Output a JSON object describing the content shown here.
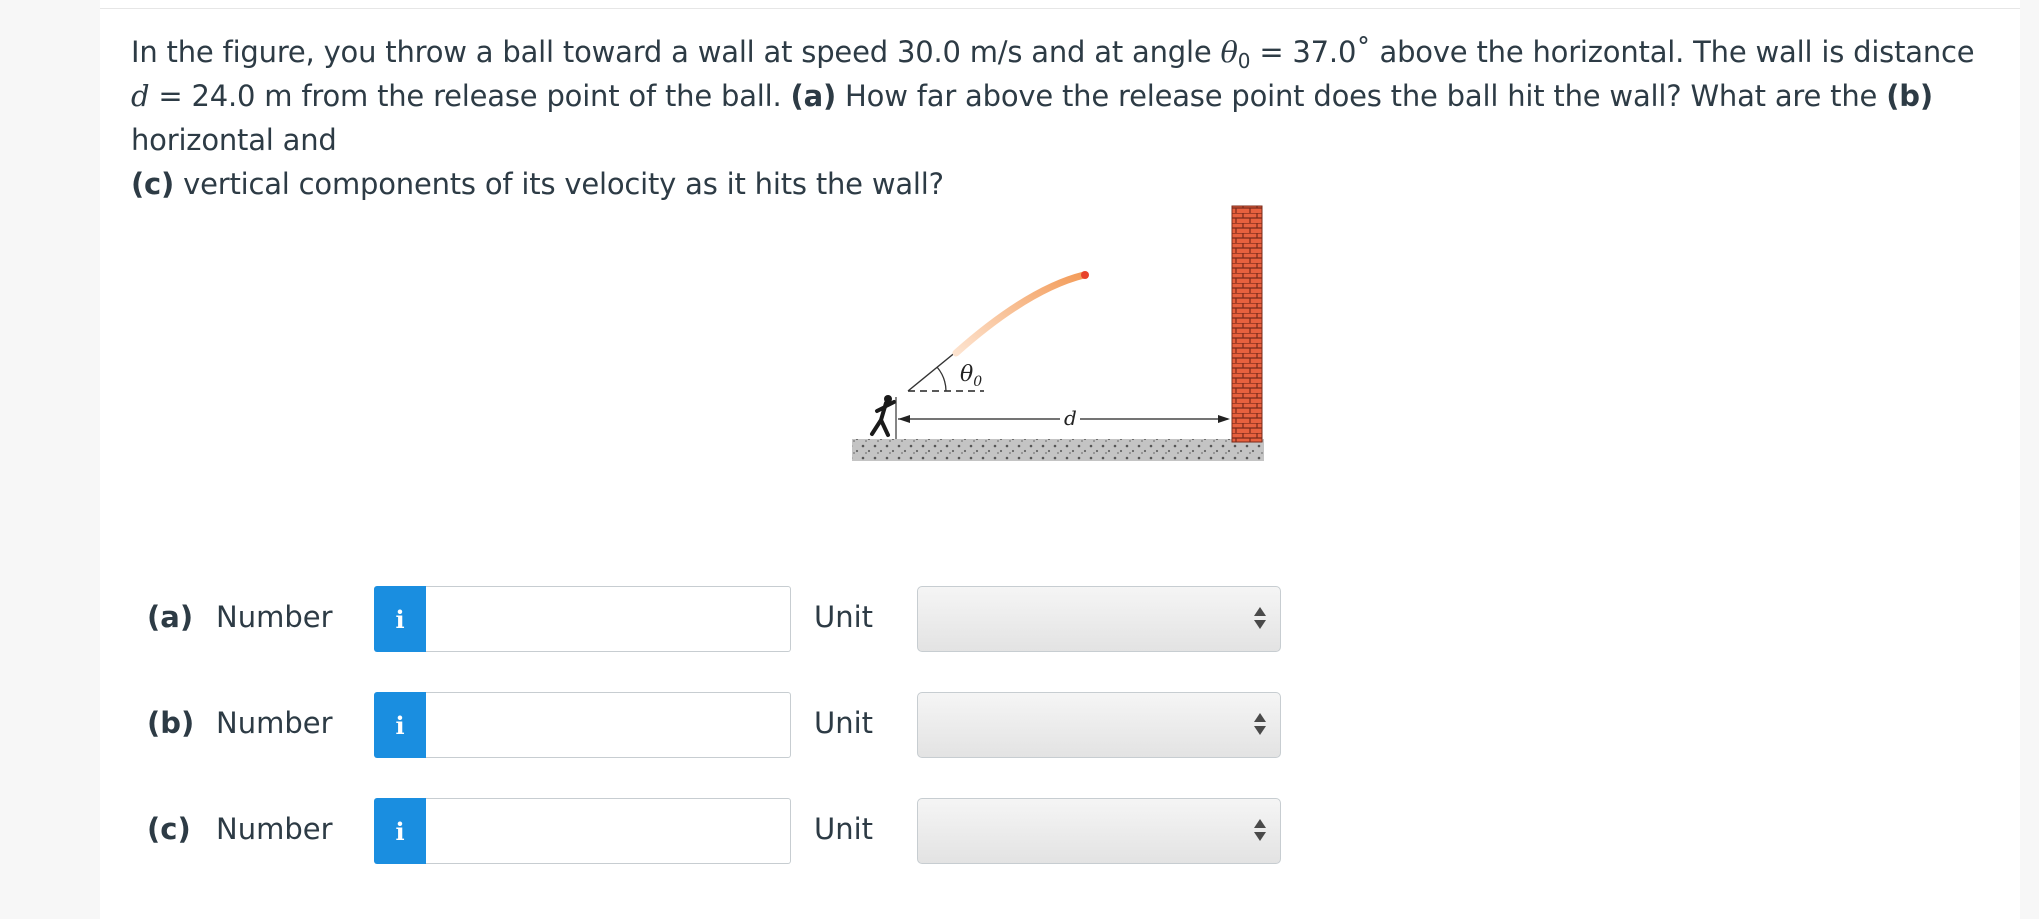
{
  "question": {
    "intro": "In the figure, you throw a ball toward a wall at speed 30.0 m/s and at angle ",
    "theta_symbol": "θ",
    "theta_sub": "0",
    "angle_text": " = 37.0˚ above the horizontal. The wall is distance ",
    "d_symbol": "d",
    "distance_text": " = 24.0 m from the release point of the ball. ",
    "part_a_tag": "(a)",
    "part_a_text": " How far above the release point does the ball hit the wall? What are the ",
    "part_b_tag": "(b)",
    "part_b_text": " horizontal and ",
    "part_c_tag": "(c)",
    "part_c_text": " vertical components of its velocity as it hits the wall?"
  },
  "figure": {
    "theta_label": "θ",
    "theta_sub": "0",
    "d_label": "d",
    "colors": {
      "ball": "#e8432a",
      "trail": "#f5b07a",
      "brick": "#e8613f",
      "mortar": "#7a2a1a",
      "ground": "#b0b0b0"
    }
  },
  "answers": [
    {
      "part": "(a)",
      "number_label": "Number",
      "info_icon": "i",
      "value": "",
      "unit_label": "Unit",
      "unit_selected": ""
    },
    {
      "part": "(b)",
      "number_label": "Number",
      "info_icon": "i",
      "value": "",
      "unit_label": "Unit",
      "unit_selected": ""
    },
    {
      "part": "(c)",
      "number_label": "Number",
      "info_icon": "i",
      "value": "",
      "unit_label": "Unit",
      "unit_selected": ""
    }
  ]
}
